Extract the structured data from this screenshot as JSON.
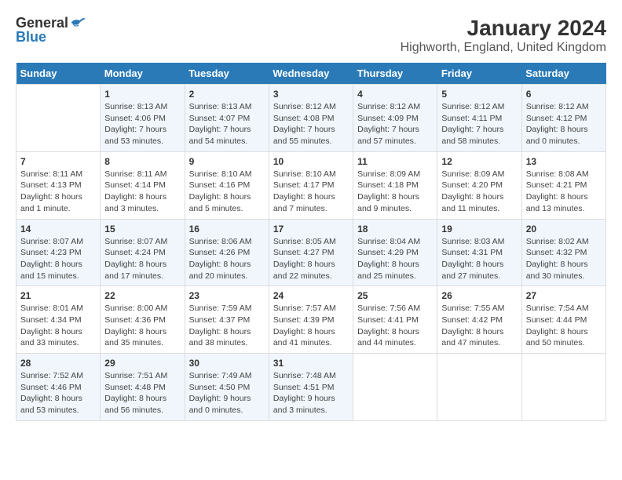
{
  "logo": {
    "text_general": "General",
    "text_blue": "Blue"
  },
  "title": "January 2024",
  "subtitle": "Highworth, England, United Kingdom",
  "days_of_week": [
    "Sunday",
    "Monday",
    "Tuesday",
    "Wednesday",
    "Thursday",
    "Friday",
    "Saturday"
  ],
  "weeks": [
    [
      {
        "day": "",
        "info": ""
      },
      {
        "day": "1",
        "info": "Sunrise: 8:13 AM\nSunset: 4:06 PM\nDaylight: 7 hours\nand 53 minutes."
      },
      {
        "day": "2",
        "info": "Sunrise: 8:13 AM\nSunset: 4:07 PM\nDaylight: 7 hours\nand 54 minutes."
      },
      {
        "day": "3",
        "info": "Sunrise: 8:12 AM\nSunset: 4:08 PM\nDaylight: 7 hours\nand 55 minutes."
      },
      {
        "day": "4",
        "info": "Sunrise: 8:12 AM\nSunset: 4:09 PM\nDaylight: 7 hours\nand 57 minutes."
      },
      {
        "day": "5",
        "info": "Sunrise: 8:12 AM\nSunset: 4:11 PM\nDaylight: 7 hours\nand 58 minutes."
      },
      {
        "day": "6",
        "info": "Sunrise: 8:12 AM\nSunset: 4:12 PM\nDaylight: 8 hours\nand 0 minutes."
      }
    ],
    [
      {
        "day": "7",
        "info": "Sunrise: 8:11 AM\nSunset: 4:13 PM\nDaylight: 8 hours\nand 1 minute."
      },
      {
        "day": "8",
        "info": "Sunrise: 8:11 AM\nSunset: 4:14 PM\nDaylight: 8 hours\nand 3 minutes."
      },
      {
        "day": "9",
        "info": "Sunrise: 8:10 AM\nSunset: 4:16 PM\nDaylight: 8 hours\nand 5 minutes."
      },
      {
        "day": "10",
        "info": "Sunrise: 8:10 AM\nSunset: 4:17 PM\nDaylight: 8 hours\nand 7 minutes."
      },
      {
        "day": "11",
        "info": "Sunrise: 8:09 AM\nSunset: 4:18 PM\nDaylight: 8 hours\nand 9 minutes."
      },
      {
        "day": "12",
        "info": "Sunrise: 8:09 AM\nSunset: 4:20 PM\nDaylight: 8 hours\nand 11 minutes."
      },
      {
        "day": "13",
        "info": "Sunrise: 8:08 AM\nSunset: 4:21 PM\nDaylight: 8 hours\nand 13 minutes."
      }
    ],
    [
      {
        "day": "14",
        "info": "Sunrise: 8:07 AM\nSunset: 4:23 PM\nDaylight: 8 hours\nand 15 minutes."
      },
      {
        "day": "15",
        "info": "Sunrise: 8:07 AM\nSunset: 4:24 PM\nDaylight: 8 hours\nand 17 minutes."
      },
      {
        "day": "16",
        "info": "Sunrise: 8:06 AM\nSunset: 4:26 PM\nDaylight: 8 hours\nand 20 minutes."
      },
      {
        "day": "17",
        "info": "Sunrise: 8:05 AM\nSunset: 4:27 PM\nDaylight: 8 hours\nand 22 minutes."
      },
      {
        "day": "18",
        "info": "Sunrise: 8:04 AM\nSunset: 4:29 PM\nDaylight: 8 hours\nand 25 minutes."
      },
      {
        "day": "19",
        "info": "Sunrise: 8:03 AM\nSunset: 4:31 PM\nDaylight: 8 hours\nand 27 minutes."
      },
      {
        "day": "20",
        "info": "Sunrise: 8:02 AM\nSunset: 4:32 PM\nDaylight: 8 hours\nand 30 minutes."
      }
    ],
    [
      {
        "day": "21",
        "info": "Sunrise: 8:01 AM\nSunset: 4:34 PM\nDaylight: 8 hours\nand 33 minutes."
      },
      {
        "day": "22",
        "info": "Sunrise: 8:00 AM\nSunset: 4:36 PM\nDaylight: 8 hours\nand 35 minutes."
      },
      {
        "day": "23",
        "info": "Sunrise: 7:59 AM\nSunset: 4:37 PM\nDaylight: 8 hours\nand 38 minutes."
      },
      {
        "day": "24",
        "info": "Sunrise: 7:57 AM\nSunset: 4:39 PM\nDaylight: 8 hours\nand 41 minutes."
      },
      {
        "day": "25",
        "info": "Sunrise: 7:56 AM\nSunset: 4:41 PM\nDaylight: 8 hours\nand 44 minutes."
      },
      {
        "day": "26",
        "info": "Sunrise: 7:55 AM\nSunset: 4:42 PM\nDaylight: 8 hours\nand 47 minutes."
      },
      {
        "day": "27",
        "info": "Sunrise: 7:54 AM\nSunset: 4:44 PM\nDaylight: 8 hours\nand 50 minutes."
      }
    ],
    [
      {
        "day": "28",
        "info": "Sunrise: 7:52 AM\nSunset: 4:46 PM\nDaylight: 8 hours\nand 53 minutes."
      },
      {
        "day": "29",
        "info": "Sunrise: 7:51 AM\nSunset: 4:48 PM\nDaylight: 8 hours\nand 56 minutes."
      },
      {
        "day": "30",
        "info": "Sunrise: 7:49 AM\nSunset: 4:50 PM\nDaylight: 9 hours\nand 0 minutes."
      },
      {
        "day": "31",
        "info": "Sunrise: 7:48 AM\nSunset: 4:51 PM\nDaylight: 9 hours\nand 3 minutes."
      },
      {
        "day": "",
        "info": ""
      },
      {
        "day": "",
        "info": ""
      },
      {
        "day": "",
        "info": ""
      }
    ]
  ]
}
